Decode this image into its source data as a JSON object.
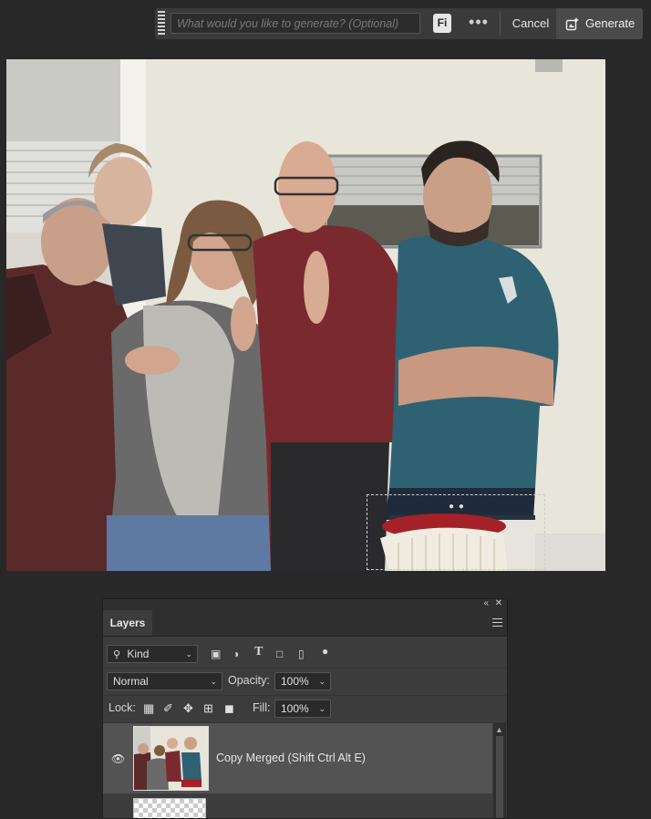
{
  "taskbar": {
    "prompt_placeholder": "What would you like to generate? (Optional)",
    "firefly_label": "Fi",
    "more_label": "•••",
    "cancel_label": "Cancel",
    "generate_label": "Generate"
  },
  "layers_panel": {
    "tab_label": "Layers",
    "filter_kind": "Kind",
    "blend_mode": "Normal",
    "opacity_label": "Opacity:",
    "opacity_value": "100%",
    "lock_label": "Lock:",
    "fill_label": "Fill:",
    "fill_value": "100%",
    "layers": [
      {
        "name": "Copy Merged (Shift Ctrl Alt E)",
        "visible": true
      },
      {
        "name": "",
        "visible": false
      }
    ]
  },
  "colors": {
    "app_background": "#282828",
    "panel_background": "#3c3c3c",
    "selected_layer": "#535353"
  }
}
